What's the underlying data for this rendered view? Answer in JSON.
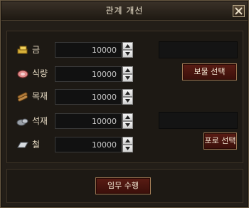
{
  "window": {
    "title": "관계 개선"
  },
  "resources": [
    {
      "label": "금",
      "value": "10000",
      "icon": "gold-icon"
    },
    {
      "label": "식량",
      "value": "10000",
      "icon": "food-icon"
    },
    {
      "label": "목재",
      "value": "10000",
      "icon": "wood-icon"
    },
    {
      "label": "석재",
      "value": "10000",
      "icon": "stone-icon"
    },
    {
      "label": "철",
      "value": "10000",
      "icon": "iron-icon"
    }
  ],
  "buttons": {
    "treasure_select": "보물 선택",
    "prisoner_select": "포로 선택",
    "perform_mission": "임무 수행"
  },
  "colors": {
    "accent_button": "#4a1610",
    "background": "#231e18",
    "border": "#a07a55"
  }
}
